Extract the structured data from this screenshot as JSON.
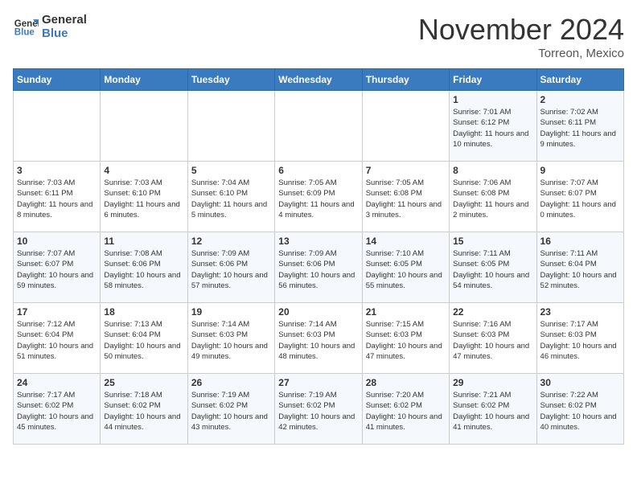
{
  "header": {
    "logo_line1": "General",
    "logo_line2": "Blue",
    "month": "November 2024",
    "location": "Torreon, Mexico"
  },
  "days_of_week": [
    "Sunday",
    "Monday",
    "Tuesday",
    "Wednesday",
    "Thursday",
    "Friday",
    "Saturday"
  ],
  "weeks": [
    [
      {
        "day": "",
        "info": ""
      },
      {
        "day": "",
        "info": ""
      },
      {
        "day": "",
        "info": ""
      },
      {
        "day": "",
        "info": ""
      },
      {
        "day": "",
        "info": ""
      },
      {
        "day": "1",
        "info": "Sunrise: 7:01 AM\nSunset: 6:12 PM\nDaylight: 11 hours and 10 minutes."
      },
      {
        "day": "2",
        "info": "Sunrise: 7:02 AM\nSunset: 6:11 PM\nDaylight: 11 hours and 9 minutes."
      }
    ],
    [
      {
        "day": "3",
        "info": "Sunrise: 7:03 AM\nSunset: 6:11 PM\nDaylight: 11 hours and 8 minutes."
      },
      {
        "day": "4",
        "info": "Sunrise: 7:03 AM\nSunset: 6:10 PM\nDaylight: 11 hours and 6 minutes."
      },
      {
        "day": "5",
        "info": "Sunrise: 7:04 AM\nSunset: 6:10 PM\nDaylight: 11 hours and 5 minutes."
      },
      {
        "day": "6",
        "info": "Sunrise: 7:05 AM\nSunset: 6:09 PM\nDaylight: 11 hours and 4 minutes."
      },
      {
        "day": "7",
        "info": "Sunrise: 7:05 AM\nSunset: 6:08 PM\nDaylight: 11 hours and 3 minutes."
      },
      {
        "day": "8",
        "info": "Sunrise: 7:06 AM\nSunset: 6:08 PM\nDaylight: 11 hours and 2 minutes."
      },
      {
        "day": "9",
        "info": "Sunrise: 7:07 AM\nSunset: 6:07 PM\nDaylight: 11 hours and 0 minutes."
      }
    ],
    [
      {
        "day": "10",
        "info": "Sunrise: 7:07 AM\nSunset: 6:07 PM\nDaylight: 10 hours and 59 minutes."
      },
      {
        "day": "11",
        "info": "Sunrise: 7:08 AM\nSunset: 6:06 PM\nDaylight: 10 hours and 58 minutes."
      },
      {
        "day": "12",
        "info": "Sunrise: 7:09 AM\nSunset: 6:06 PM\nDaylight: 10 hours and 57 minutes."
      },
      {
        "day": "13",
        "info": "Sunrise: 7:09 AM\nSunset: 6:06 PM\nDaylight: 10 hours and 56 minutes."
      },
      {
        "day": "14",
        "info": "Sunrise: 7:10 AM\nSunset: 6:05 PM\nDaylight: 10 hours and 55 minutes."
      },
      {
        "day": "15",
        "info": "Sunrise: 7:11 AM\nSunset: 6:05 PM\nDaylight: 10 hours and 54 minutes."
      },
      {
        "day": "16",
        "info": "Sunrise: 7:11 AM\nSunset: 6:04 PM\nDaylight: 10 hours and 52 minutes."
      }
    ],
    [
      {
        "day": "17",
        "info": "Sunrise: 7:12 AM\nSunset: 6:04 PM\nDaylight: 10 hours and 51 minutes."
      },
      {
        "day": "18",
        "info": "Sunrise: 7:13 AM\nSunset: 6:04 PM\nDaylight: 10 hours and 50 minutes."
      },
      {
        "day": "19",
        "info": "Sunrise: 7:14 AM\nSunset: 6:03 PM\nDaylight: 10 hours and 49 minutes."
      },
      {
        "day": "20",
        "info": "Sunrise: 7:14 AM\nSunset: 6:03 PM\nDaylight: 10 hours and 48 minutes."
      },
      {
        "day": "21",
        "info": "Sunrise: 7:15 AM\nSunset: 6:03 PM\nDaylight: 10 hours and 47 minutes."
      },
      {
        "day": "22",
        "info": "Sunrise: 7:16 AM\nSunset: 6:03 PM\nDaylight: 10 hours and 47 minutes."
      },
      {
        "day": "23",
        "info": "Sunrise: 7:17 AM\nSunset: 6:03 PM\nDaylight: 10 hours and 46 minutes."
      }
    ],
    [
      {
        "day": "24",
        "info": "Sunrise: 7:17 AM\nSunset: 6:02 PM\nDaylight: 10 hours and 45 minutes."
      },
      {
        "day": "25",
        "info": "Sunrise: 7:18 AM\nSunset: 6:02 PM\nDaylight: 10 hours and 44 minutes."
      },
      {
        "day": "26",
        "info": "Sunrise: 7:19 AM\nSunset: 6:02 PM\nDaylight: 10 hours and 43 minutes."
      },
      {
        "day": "27",
        "info": "Sunrise: 7:19 AM\nSunset: 6:02 PM\nDaylight: 10 hours and 42 minutes."
      },
      {
        "day": "28",
        "info": "Sunrise: 7:20 AM\nSunset: 6:02 PM\nDaylight: 10 hours and 41 minutes."
      },
      {
        "day": "29",
        "info": "Sunrise: 7:21 AM\nSunset: 6:02 PM\nDaylight: 10 hours and 41 minutes."
      },
      {
        "day": "30",
        "info": "Sunrise: 7:22 AM\nSunset: 6:02 PM\nDaylight: 10 hours and 40 minutes."
      }
    ]
  ]
}
